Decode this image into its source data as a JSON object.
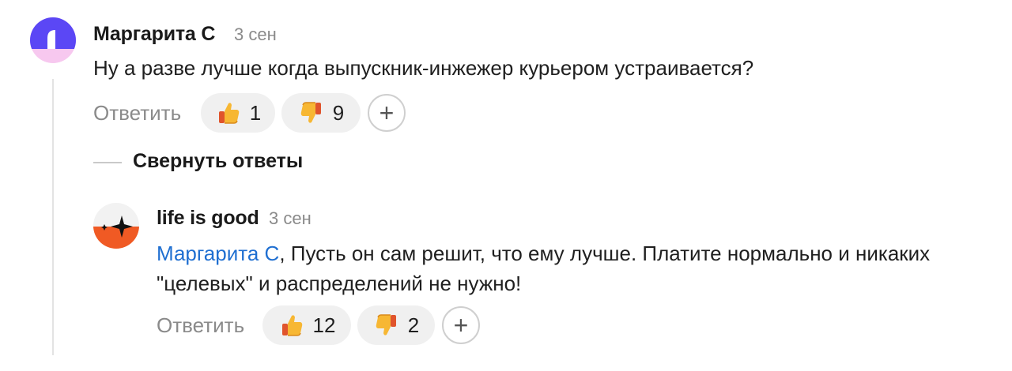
{
  "comments": [
    {
      "author": "Маргарита С",
      "time": "3 сен",
      "text": "Ну а разве лучше когда выпускник-инжежер курьером устраивается?",
      "reply_label": "Ответить",
      "likes": "1",
      "dislikes": "9",
      "add_reaction": "+"
    },
    {
      "author": "life is good",
      "time": "3 сен",
      "mention": "Маргарита С",
      "text_line1": ", Пусть он сам решит, что ему лучше. Платите нормально и никаких",
      "text_line2": "\"целевых\" и распределений не нужно!",
      "reply_label": "Ответить",
      "likes": "12",
      "dislikes": "2",
      "add_reaction": "+"
    }
  ],
  "collapse_replies_label": "Свернуть ответы",
  "icons": {
    "like": "thumbs-up-icon",
    "dislike": "thumbs-down-icon",
    "add": "plus-icon"
  },
  "colors": {
    "mention": "#1f6fd1",
    "reaction_bg": "#f0f0f0",
    "meta": "#8a8a8a"
  }
}
